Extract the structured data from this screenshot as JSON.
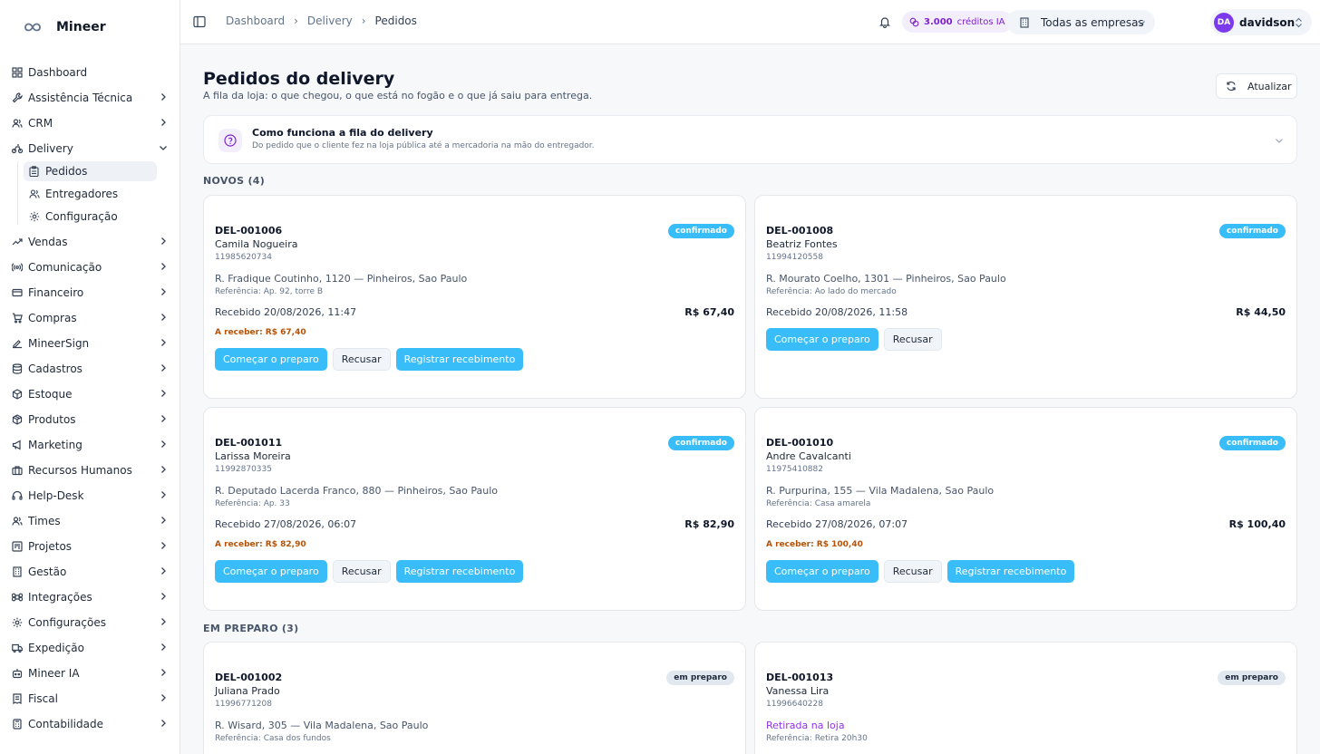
{
  "brand": {
    "name": "Mineer"
  },
  "sidebar": {
    "items": [
      {
        "label": "Dashboard",
        "icon": "grid-icon",
        "chevron": false
      },
      {
        "label": "Assistência Técnica",
        "icon": "wrench-icon",
        "chevron": true
      },
      {
        "label": "CRM",
        "icon": "users-icon",
        "chevron": true
      },
      {
        "label": "Delivery",
        "icon": "bike-icon",
        "chevron": true,
        "expanded": true
      },
      {
        "label": "Vendas",
        "icon": "trending-up-icon",
        "chevron": true
      },
      {
        "label": "Comunicação",
        "icon": "broadcast-icon",
        "chevron": true
      },
      {
        "label": "Financeiro",
        "icon": "credit-card-icon",
        "chevron": true
      },
      {
        "label": "Compras",
        "icon": "cart-icon",
        "chevron": true
      },
      {
        "label": "MineerSign",
        "icon": "signature-icon",
        "chevron": true
      },
      {
        "label": "Cadastros",
        "icon": "database-icon",
        "chevron": true
      },
      {
        "label": "Estoque",
        "icon": "box-icon",
        "chevron": true
      },
      {
        "label": "Produtos",
        "icon": "package-icon",
        "chevron": true
      },
      {
        "label": "Marketing",
        "icon": "megaphone-icon",
        "chevron": true
      },
      {
        "label": "Recursos Humanos",
        "icon": "briefcase-icon",
        "chevron": true
      },
      {
        "label": "Help-Desk",
        "icon": "headset-icon",
        "chevron": true
      },
      {
        "label": "Times",
        "icon": "team-icon",
        "chevron": true
      },
      {
        "label": "Projetos",
        "icon": "kanban-icon",
        "chevron": true
      },
      {
        "label": "Gestão",
        "icon": "building-icon",
        "chevron": true
      },
      {
        "label": "Integrações",
        "icon": "command-icon",
        "chevron": true
      },
      {
        "label": "Configurações",
        "icon": "gear-icon",
        "chevron": true
      },
      {
        "label": "Expedição",
        "icon": "truck-icon",
        "chevron": true
      },
      {
        "label": "Mineer IA",
        "icon": "bot-icon",
        "chevron": true
      },
      {
        "label": "Fiscal",
        "icon": "receipt-icon",
        "chevron": true
      },
      {
        "label": "Contabilidade",
        "icon": "calculator-icon",
        "chevron": true
      }
    ],
    "delivery_sub": [
      {
        "label": "Pedidos",
        "icon": "clipboard-icon",
        "active": true
      },
      {
        "label": "Entregadores",
        "icon": "users-icon",
        "active": false
      },
      {
        "label": "Configuração",
        "icon": "gear-icon",
        "active": false
      }
    ]
  },
  "topbar": {
    "breadcrumb": [
      "Dashboard",
      "Delivery",
      "Pedidos"
    ],
    "credits_value": "3.000",
    "credits_label": "créditos IA",
    "company": "Todas as empresas",
    "user_initials": "DA",
    "user_name": "davidson"
  },
  "page": {
    "title": "Pedidos do delivery",
    "subtitle": "A fila da loja: o que chegou, o que está no fogão e o que já saiu para entrega.",
    "refresh_label": "Atualizar"
  },
  "info": {
    "title": "Como funciona a fila do delivery",
    "subtitle": "Do pedido que o cliente fez na loja pública até a mercadoria na mão do entregador."
  },
  "sections": {
    "novos": "NOVOS (4)",
    "preparo": "EM PREPARO (3)"
  },
  "labels": {
    "start": "Começar o preparo",
    "refuse": "Recusar",
    "register": "Registrar recebimento"
  },
  "orders": [
    {
      "code": "DEL-001006",
      "name": "Camila Nogueira",
      "phone": "11985620734",
      "address": "R. Fradique Coutinho, 1120 — Pinheiros, Sao Paulo",
      "ref": "Referência: Ap. 92, torre B",
      "received": "Recebido 20/08/2026, 11:47",
      "total": "R$ 67,40",
      "due": "A receber: R$ 67,40",
      "status": "confirmado"
    },
    {
      "code": "DEL-001008",
      "name": "Beatriz Fontes",
      "phone": "11994120558",
      "address": "R. Mourato Coelho, 1301 — Pinheiros, Sao Paulo",
      "ref": "Referência: Ao lado do mercado",
      "received": "Recebido 20/08/2026, 11:58",
      "total": "R$ 44,50",
      "due": "",
      "status": "confirmado"
    },
    {
      "code": "DEL-001011",
      "name": "Larissa Moreira",
      "phone": "11992870335",
      "address": "R. Deputado Lacerda Franco, 880 — Pinheiros, Sao Paulo",
      "ref": "Referência: Ap. 33",
      "received": "Recebido 27/08/2026, 06:07",
      "total": "R$ 82,90",
      "due": "A receber: R$ 82,90",
      "status": "confirmado"
    },
    {
      "code": "DEL-001010",
      "name": "Andre Cavalcanti",
      "phone": "11975410882",
      "address": "R. Purpurina, 155 — Vila Madalena, Sao Paulo",
      "ref": "Referência: Casa amarela",
      "received": "Recebido 27/08/2026, 07:07",
      "total": "R$ 100,40",
      "due": "A receber: R$ 100,40",
      "status": "confirmado"
    },
    {
      "code": "DEL-001002",
      "name": "Juliana Prado",
      "phone": "11996771208",
      "address": "R. Wisard, 305 — Vila Madalena, Sao Paulo",
      "ref": "Referência: Casa dos fundos",
      "status": "em preparo"
    },
    {
      "code": "DEL-001013",
      "name": "Vanessa Lira",
      "phone": "11996640228",
      "address": "Retirada na loja",
      "ref": "Referência: Retira 20h30",
      "status": "em preparo"
    }
  ]
}
